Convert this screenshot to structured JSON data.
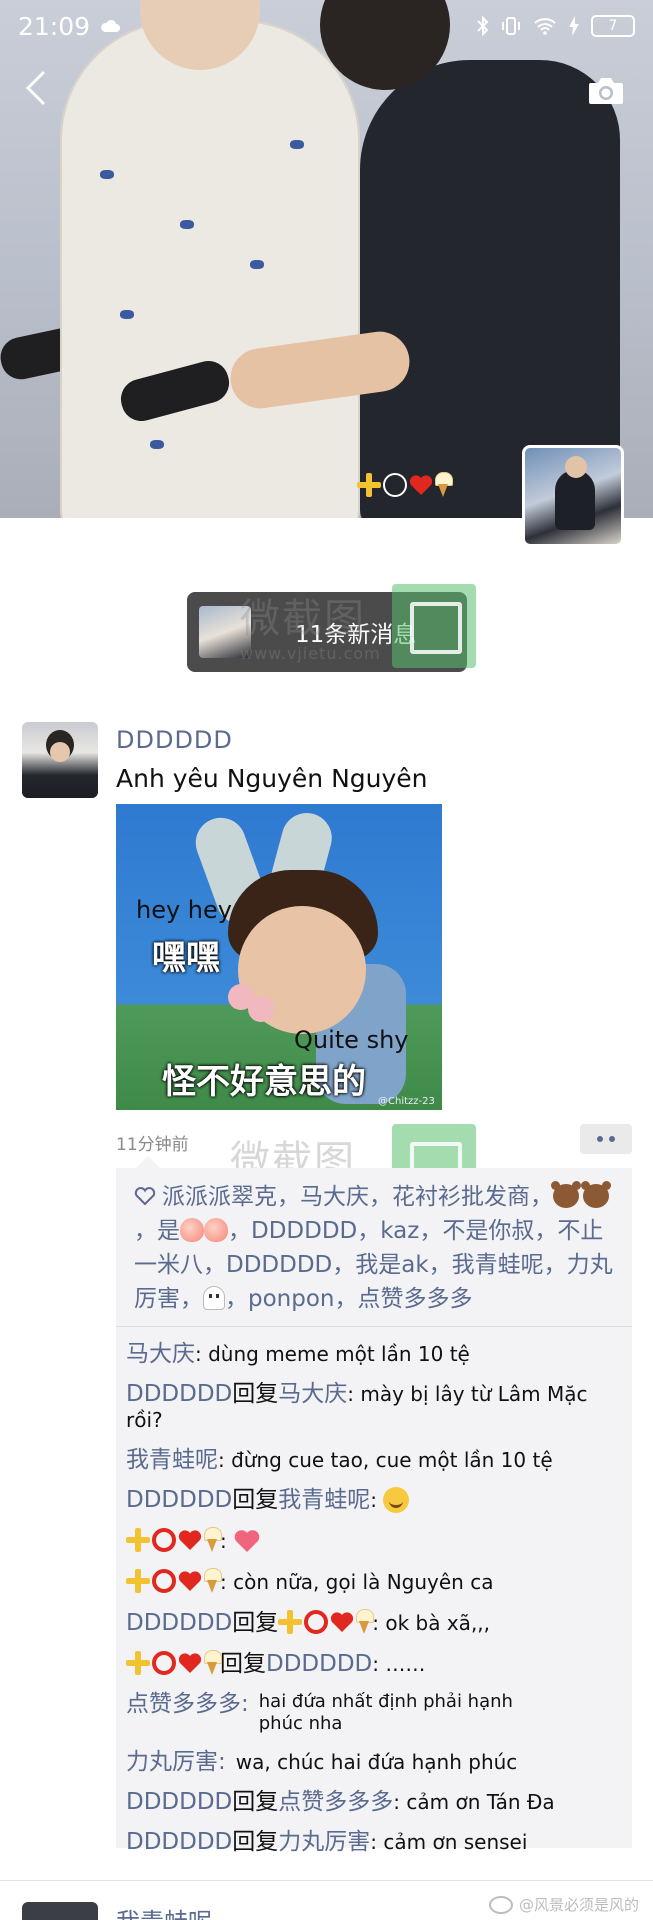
{
  "status_bar": {
    "time": "21:09",
    "battery": "7"
  },
  "cover": {
    "name": "✚○❤️🍦"
  },
  "new_messages": {
    "label": "11条新消息"
  },
  "watermarks": {
    "brand": "微截图",
    "url": "www.vjietu.com"
  },
  "post": {
    "author": "DDDDDD",
    "text": "Anh yêu Nguyên Nguyên",
    "image": {
      "caption_en_1": "hey hey",
      "caption_cn_1": "嘿嘿",
      "caption_en_2": "Quite shy",
      "caption_cn_2": "怪不好意思的",
      "credit": "@Chitzz-23"
    },
    "time": "11分钟前"
  },
  "likes": {
    "segments": [
      "派派派翠克，马大庆，花衬衫批发商，",
      "，是",
      "，DDDDDD，kaz，不是你叔，不止一米八，DDDDDD，我是ak，我青蛙呢，力丸厉害，",
      "，ponpon，点赞多多多"
    ]
  },
  "comments": [
    {
      "from": "马大庆",
      "text": ": dùng meme một lần 10 tệ"
    },
    {
      "from": "DDDDDD",
      "reply_word": "回复",
      "to": "马大庆",
      "text": ": mày bị lây từ Lâm Mặc rồi?"
    },
    {
      "from": "我青蛙呢",
      "text": ": đừng cue tao, cue một lần 10 tệ"
    },
    {
      "from": "DDDDDD",
      "reply_word": "回复",
      "to": "我青蛙呢",
      "text": ": "
    },
    {
      "text": ": "
    },
    {
      "text": ": còn nữa, gọi là Nguyên ca"
    },
    {
      "from": "DDDDDD",
      "reply_word": "回复",
      "text": ":  ok bà xã,,,"
    },
    {
      "reply_word": "回复",
      "to": "DDDDDD",
      "text": ": ……"
    },
    {
      "from": "点赞多多多:",
      "text": "hai đứa nhất định phải hạnh phúc nha"
    },
    {
      "from": "力丸厉害:",
      "text": "wa, chúc hai đứa hạnh phúc"
    },
    {
      "from": "DDDDDD",
      "reply_word": "回复",
      "to": "点赞多多多",
      "text": ": cảm ơn Tán Đa"
    },
    {
      "from": "DDDDDD",
      "reply_word": "回复",
      "to": "力丸厉害",
      "text": ": cảm ơn sensei"
    }
  ],
  "next_post": {
    "author": "我青蛙呢"
  },
  "weibo_watermark": {
    "text": "@风景必须是风的"
  },
  "colors": {
    "link": "#5a6b8f",
    "pill_bg": "#4b4b4b",
    "comment_bg": "#f3f3f5"
  },
  "icons": [
    "back-icon",
    "camera-icon",
    "heart-outline-icon",
    "more-icon",
    "plus-emoji",
    "ring-emoji",
    "heart-emoji",
    "icecream-emoji",
    "bear-emoji",
    "peach-emoji",
    "ghost-emoji",
    "smile-emoji"
  ]
}
